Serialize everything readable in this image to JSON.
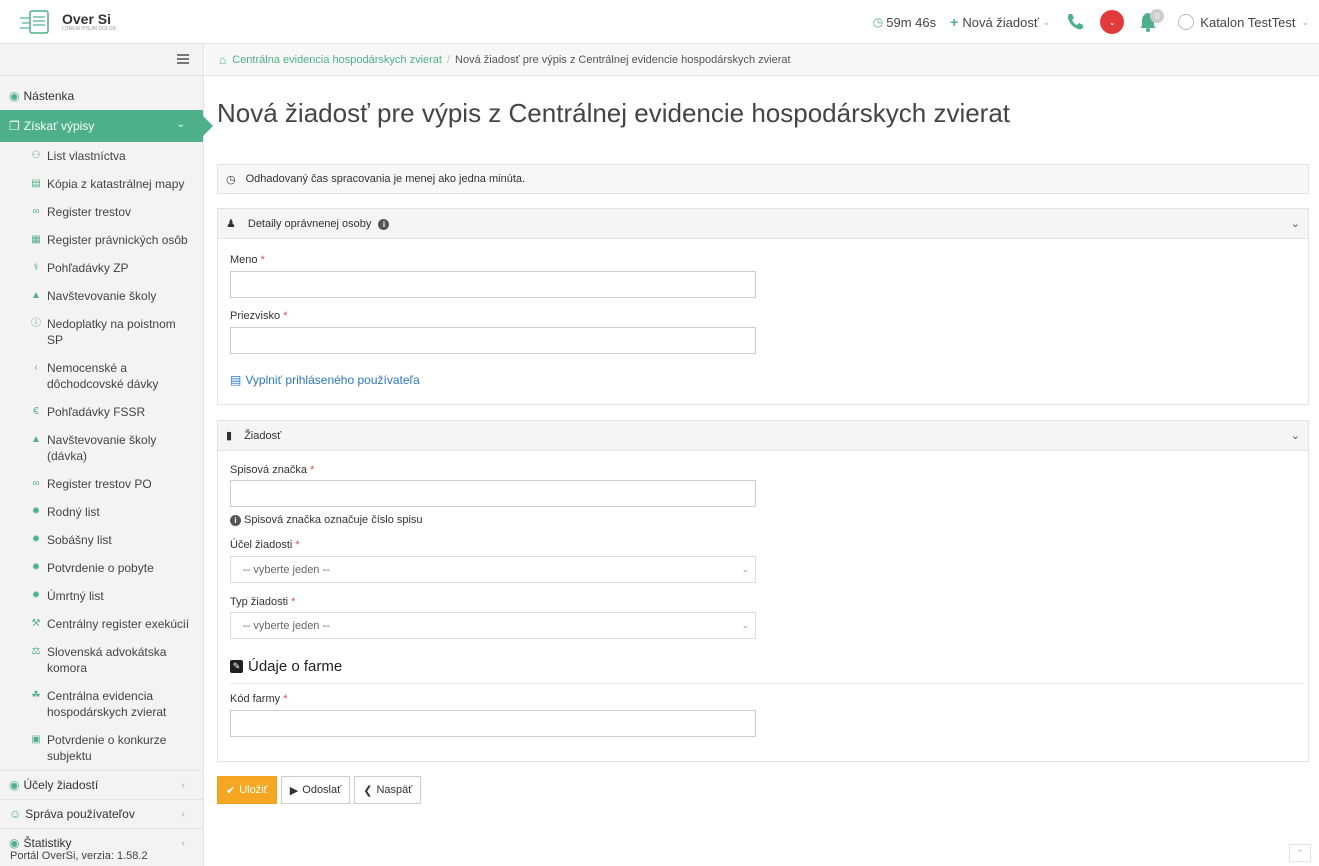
{
  "header": {
    "brand": "Over Si",
    "brand_sub": "LOREM IPSUM DOLOR",
    "timer": "59m 46s",
    "new_request": "Nová žiadosť",
    "notif_count": "0",
    "user": "Katalon TestTest"
  },
  "sidebar": {
    "dashboard": "Nástenka",
    "get_extracts": "Získať výpisy",
    "items": [
      {
        "label": "List vlastníctva",
        "icon": "users-icon"
      },
      {
        "label": "Kópia z katastrálnej mapy",
        "icon": "map-icon"
      },
      {
        "label": "Register trestov",
        "icon": "link-icon"
      },
      {
        "label": "Register právnických osôb",
        "icon": "building-icon"
      },
      {
        "label": "Pohľadávky ZP",
        "icon": "stethoscope-icon"
      },
      {
        "label": "Navštevovanie školy",
        "icon": "graduation-cap-icon"
      },
      {
        "label": "Nedoplatky na poistnom SP",
        "icon": "info-icon"
      },
      {
        "label": "Nemocenské a dôchodcovské dávky",
        "icon": "share-icon"
      },
      {
        "label": "Pohľadávky FSSR",
        "icon": "euro-icon"
      },
      {
        "label": "Navštevovanie školy (dávka)",
        "icon": "graduation-cap-icon"
      },
      {
        "label": "Register trestov PO",
        "icon": "link-icon"
      },
      {
        "label": "Rodný list",
        "icon": "certificate-icon"
      },
      {
        "label": "Sobášny list",
        "icon": "certificate-icon"
      },
      {
        "label": "Potvrdenie o pobyte",
        "icon": "certificate-icon"
      },
      {
        "label": "Úmrtný list",
        "icon": "certificate-icon"
      },
      {
        "label": "Centrálny register exekúcií",
        "icon": "gavel-icon"
      },
      {
        "label": "Slovenská advokátska komora",
        "icon": "balance-scale-icon"
      },
      {
        "label": "Centrálna evidencia hospodárskych zvierat",
        "icon": "leaf-icon"
      },
      {
        "label": "Potvrdenie o konkurze subjektu",
        "icon": "money-icon"
      }
    ],
    "purposes": "Účely žiadostí",
    "user_management": "Správa používateľov",
    "statistics": "Štatistiky",
    "version": "Portál OverSi, verzia: 1.58.2"
  },
  "breadcrumb": {
    "parent": "Centrálna evidencia hospodárskych zvierat",
    "current": "Nová žiadosť pre výpis z Centrálnej evidencie hospodárskych zvierat"
  },
  "page": {
    "title": "Nová žiadosť pre výpis z Centrálnej evidencie hospodárskych zvierat",
    "processing_info": "Odhadovaný čas spracovania je menej ako jedna minúta."
  },
  "person_panel": {
    "title": "Detaily oprávnenej osoby",
    "first_name_label": "Meno",
    "last_name_label": "Priezvisko",
    "fill_link": "Vyplniť prihláseného používateľa"
  },
  "request_panel": {
    "title": "Žiadosť",
    "file_number_label": "Spisová značka",
    "file_number_hint": "Spisová značka označuje číslo spisu",
    "purpose_label": "Účel žiadosti",
    "purpose_value": "-- vyberte jeden --",
    "type_label": "Typ žiadosti",
    "type_value": "-- vyberte jeden --",
    "farm_heading": "Údaje o farme",
    "farm_code_label": "Kód farmy"
  },
  "buttons": {
    "save": "Uložiť",
    "send": "Odoslať",
    "back": "Naspäť"
  },
  "colors": {
    "accent": "#4db08a",
    "save": "#f5a623",
    "required": "#d9534f",
    "link": "#2a78c2"
  }
}
